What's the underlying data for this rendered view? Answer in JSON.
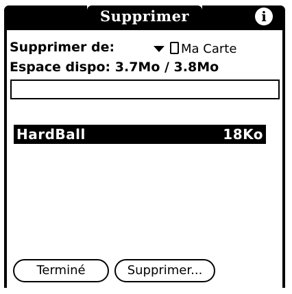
{
  "window": {
    "title": "Supprimer",
    "info_icon": "info-icon"
  },
  "delete_from": {
    "label": "Supprimer de:",
    "selected_value": "Ma Carte",
    "icon": "card-icon"
  },
  "space": {
    "label": "Espace dispo: 3.7Mo / 3.8Mo"
  },
  "storage": {
    "used_fraction": 0.0
  },
  "apps": [
    {
      "name": "HardBall",
      "size": "18Ko",
      "selected": true
    }
  ],
  "buttons": {
    "done_label": "Terminé",
    "delete_label": "Supprimer..."
  },
  "colors": {
    "foreground": "#000000",
    "background": "#ffffff"
  }
}
